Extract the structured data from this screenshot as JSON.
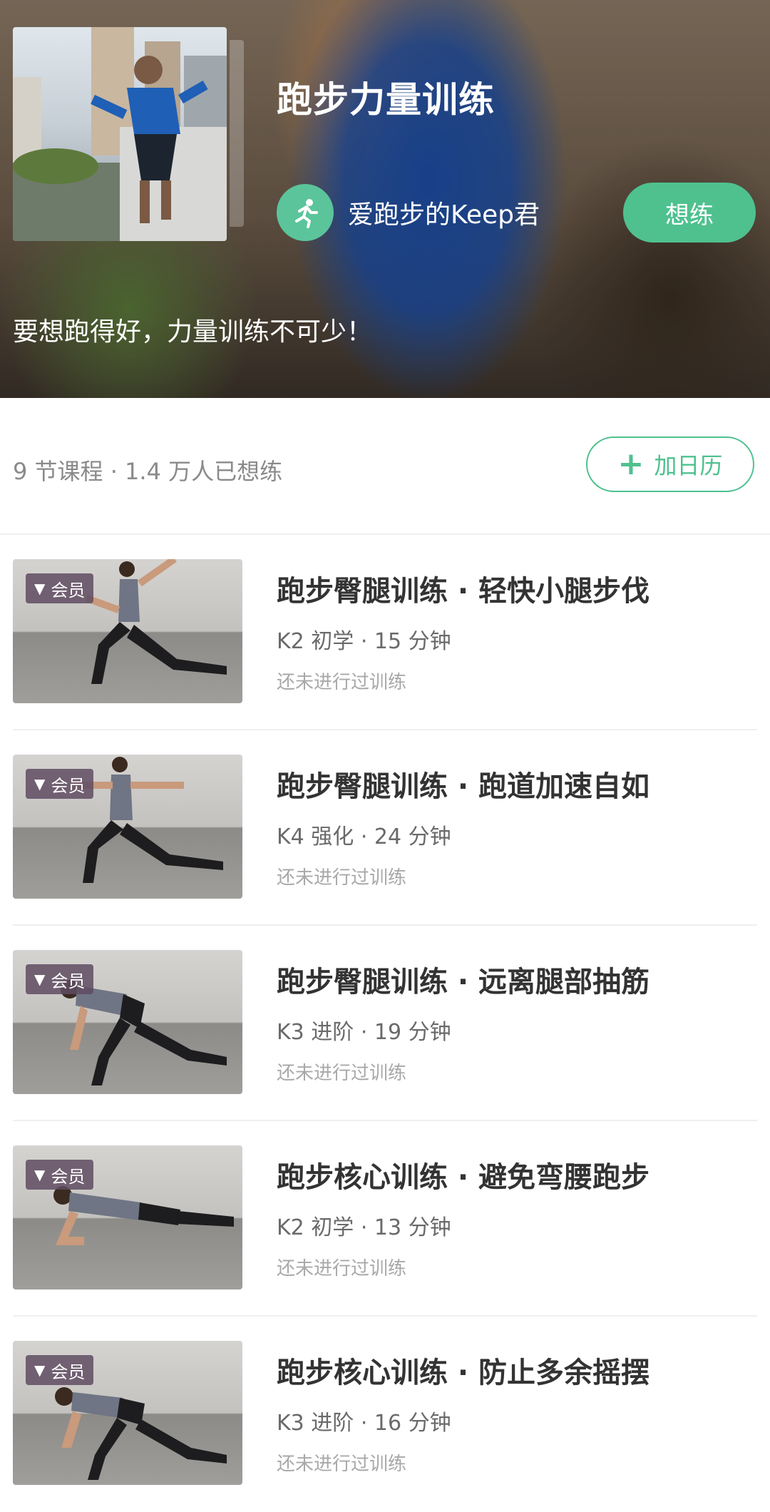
{
  "hero": {
    "title": "跑步力量训练",
    "author": "爱跑步的Keep君",
    "want_button": "想练",
    "description": "要想跑得好，力量训练不可少！"
  },
  "stats": {
    "summary": "9 节课程 · 1.4 万人已想练",
    "calendar_button": "加日历"
  },
  "badge_label": "会员",
  "courses": [
    {
      "title": "跑步臀腿训练 · 轻快小腿步伐",
      "meta": "K2 初学 · 15 分钟",
      "status": "还未进行过训练"
    },
    {
      "title": "跑步臀腿训练 · 跑道加速自如",
      "meta": "K4 强化 · 24 分钟",
      "status": "还未进行过训练"
    },
    {
      "title": "跑步臀腿训练 · 远离腿部抽筋",
      "meta": "K3 进阶 · 19 分钟",
      "status": "还未进行过训练"
    },
    {
      "title": "跑步核心训练 · 避免弯腰跑步",
      "meta": "K2 初学 · 13 分钟",
      "status": "还未进行过训练"
    },
    {
      "title": "跑步核心训练 · 防止多余摇摆",
      "meta": "K3 进阶 · 16 分钟",
      "status": "还未进行过训练"
    }
  ],
  "colors": {
    "accent": "#4fc18f",
    "badge": "#5f4c62"
  },
  "icons": [
    "runner-icon",
    "plus-icon",
    "member-diamond-icon"
  ]
}
